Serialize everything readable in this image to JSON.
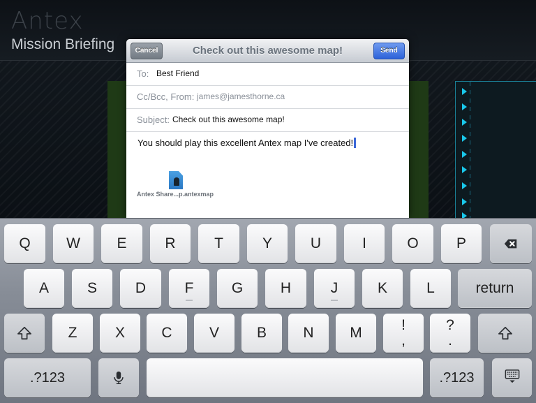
{
  "app": {
    "title": "Antex",
    "subtitle": "Mission Briefing"
  },
  "mail": {
    "title": "Check out this awesome map!",
    "cancel_label": "Cancel",
    "send_label": "Send",
    "to_label": "To:",
    "to_value": "Best Friend",
    "ccbcc_label": "Cc/Bcc, From:",
    "from_value": "james@jamesthorne.ca",
    "subject_label": "Subject:",
    "subject_value": "Check out this awesome map!",
    "body": "You should play this excellent Antex map I've created!",
    "attachment_name": "Antex Share...p.antexmap",
    "attachment_icon": "document-icon"
  },
  "keyboard": {
    "row1": [
      "Q",
      "W",
      "E",
      "R",
      "T",
      "Y",
      "U",
      "I",
      "O",
      "P"
    ],
    "row2": [
      "A",
      "S",
      "D",
      "F",
      "G",
      "H",
      "J",
      "K",
      "L"
    ],
    "row3": [
      "Z",
      "X",
      "C",
      "V",
      "B",
      "N",
      "M"
    ],
    "return_label": "return",
    "excl_top": "!",
    "excl_bottom": ",",
    "question_top": "?",
    "question_bottom": ".",
    "numbers_label": ".?123",
    "icons": {
      "backspace": "backspace-icon",
      "shift": "shift-icon",
      "mic": "microphone-icon",
      "hide": "keyboard-hide-icon"
    }
  },
  "colors": {
    "send_button": "#2d62d9",
    "caret": "#3b67d8",
    "accent_cyan": "#19c7ea"
  }
}
